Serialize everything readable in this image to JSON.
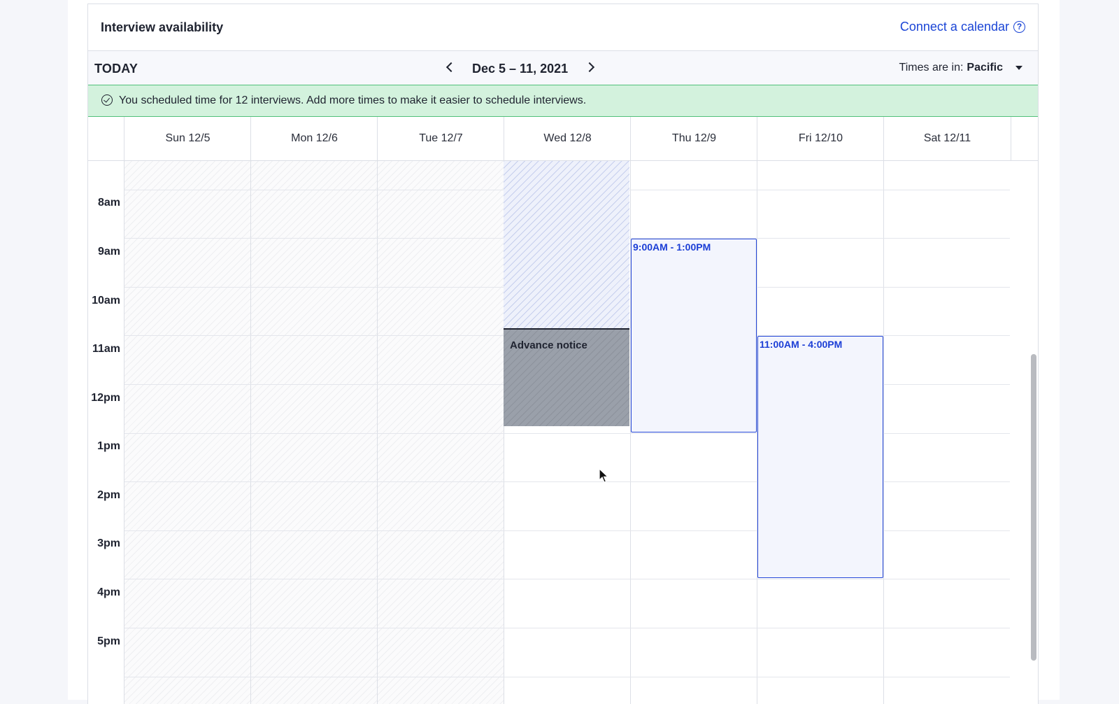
{
  "header": {
    "title": "Interview availability",
    "connect_label": "Connect a calendar",
    "help_glyph": "?"
  },
  "toolbar": {
    "today_label": "TODAY",
    "date_range": "Dec 5 – 11, 2021",
    "timezone_prefix": "Times are in:",
    "timezone_value": "Pacific"
  },
  "banner": {
    "message": "You scheduled time for 12 interviews. Add more times to make it easier to schedule interviews.",
    "color": "#d3f2dd"
  },
  "calendar": {
    "days": [
      {
        "label": "Sun 12/5"
      },
      {
        "label": "Mon 12/6"
      },
      {
        "label": "Tue 12/7"
      },
      {
        "label": "Wed 12/8"
      },
      {
        "label": "Thu 12/9"
      },
      {
        "label": "Fri 12/10"
      },
      {
        "label": "Sat 12/11"
      }
    ],
    "hours": [
      "8am",
      "9am",
      "10am",
      "11am",
      "12pm",
      "1pm",
      "2pm",
      "3pm",
      "4pm",
      "5pm"
    ],
    "advance_notice_label": "Advance notice",
    "slots": [
      {
        "day": "Thu 12/9",
        "label": "9:00AM - 1:00PM"
      },
      {
        "day": "Fri 12/10",
        "label": "11:00AM - 4:00PM"
      }
    ]
  },
  "colors": {
    "accent": "#1b45d6",
    "slot_border": "#2547d8",
    "notice": "#9aa0aa"
  }
}
